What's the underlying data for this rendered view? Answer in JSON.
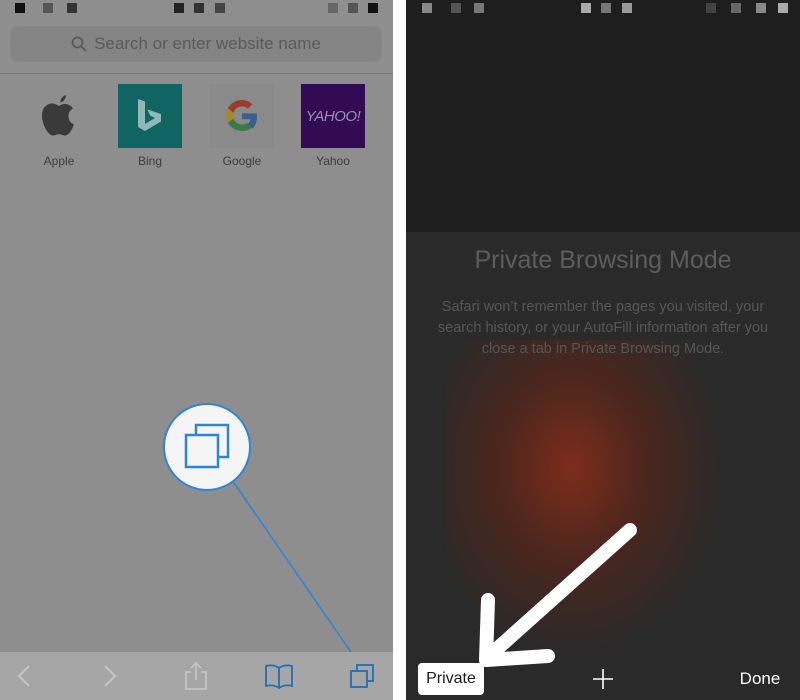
{
  "left_screen": {
    "search": {
      "placeholder": "Search or enter website name"
    },
    "favorites": [
      {
        "label": "Apple",
        "icon": "apple-logo-icon"
      },
      {
        "label": "Bing",
        "icon": "bing-logo-icon"
      },
      {
        "label": "Google",
        "icon": "google-logo-icon"
      },
      {
        "label": "Yahoo",
        "icon": "yahoo-logo-icon",
        "tile_text": "YAHOO!"
      }
    ],
    "toolbar": {
      "items": [
        "back-icon",
        "forward-icon",
        "share-icon",
        "bookmarks-icon",
        "tabs-icon"
      ]
    },
    "callout_icon": "tabs-icon",
    "accent_color": "#2c85d8"
  },
  "right_screen": {
    "title": "Private Browsing Mode",
    "description": "Safari won’t remember the pages you visited, your search history, or your AutoFill information after you close a tab in Private Browsing Mode.",
    "toolbar": {
      "private_label": "Private",
      "new_tab_icon": "plus-icon",
      "done_label": "Done"
    },
    "annotation_icon": "arrow-icon"
  }
}
